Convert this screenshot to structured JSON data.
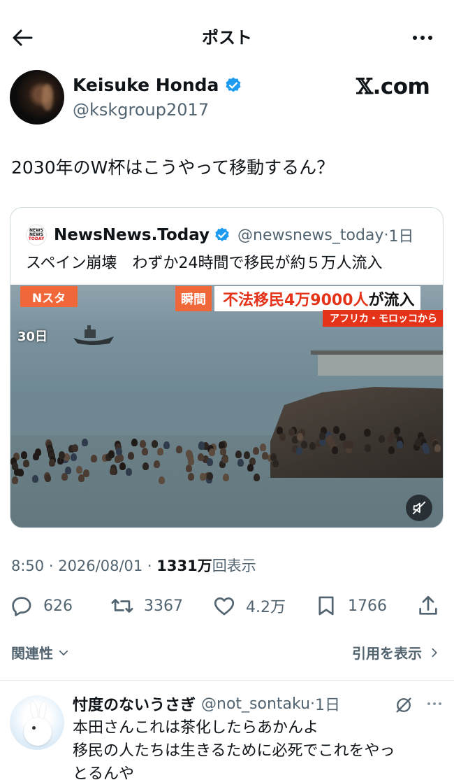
{
  "header": {
    "title": "ポスト",
    "back_icon": "arrow-left-icon",
    "more_icon": "more-horizontal-icon"
  },
  "author": {
    "name": "Keisuke Honda",
    "handle": "@kskgroup2017",
    "verified": true,
    "verified_color": "#1d9bf0"
  },
  "watermark": {
    "x_letter": "𝕏",
    "domain": ".com"
  },
  "tweet": {
    "text": "2030年のW杯はこうやって移動するん？"
  },
  "quote": {
    "logo_lines": [
      "NEWS",
      "NEWS",
      "TODAY"
    ],
    "name": "NewsNews.Today",
    "handle": "@newsnews_today",
    "sep": "·",
    "time": "1日",
    "text": "スペイン崩壊　わずか24時間で移民が約５万人流入",
    "media": {
      "badge": "Nスタ",
      "date": "30日",
      "caption_tag": "瞬間",
      "caption_main_red": "不法移民4万9000人",
      "caption_main_black": "が流入",
      "caption_sub": "アフリカ・モロッコから",
      "mute_icon": "volume-muted-icon"
    }
  },
  "meta": {
    "time": "8:50",
    "sep1": " · ",
    "date": "2026/08/01",
    "sep2": " · ",
    "views": "1331万",
    "views_label": "回表示"
  },
  "actions": {
    "reply_count": "626",
    "retweet_count": "3367",
    "like_count": "4.2万",
    "bookmark_count": "1766"
  },
  "relevance": {
    "sort_label": "関連性",
    "quotes_label": "引用を表示"
  },
  "reply": {
    "name": "忖度のないうさぎ",
    "handle": "@not_sontaku",
    "sep": "·",
    "time": "1日",
    "lines": [
      "本田さんこれは茶化したらあかんよ",
      "移民の人たちは生きるために必死でこれをやっ",
      "とるんや"
    ]
  },
  "colors": {
    "text_primary": "#0f1419",
    "text_secondary": "#536471",
    "accent": "#1d9bf0",
    "border": "#cfd9de",
    "caption_orange": "#f0683a",
    "caption_red": "#e53319"
  }
}
